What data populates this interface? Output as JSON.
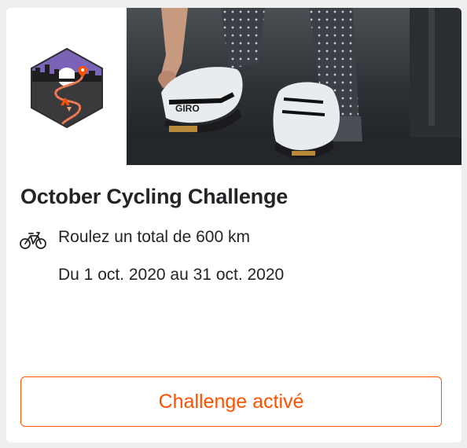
{
  "challenge": {
    "title": "October Cycling Challenge",
    "goal": "Roulez un total de 600 km",
    "dates": "Du 1 oct. 2020 au 31 oct. 2020",
    "sport_icon": "bike-icon"
  },
  "hero": {
    "shoe_brand": "GIRO"
  },
  "action": {
    "label": "Challenge activé"
  },
  "colors": {
    "accent": "#fc5200",
    "badge_purple": "#7b64b8",
    "badge_dark": "#3a3a3c",
    "text": "#242428"
  }
}
